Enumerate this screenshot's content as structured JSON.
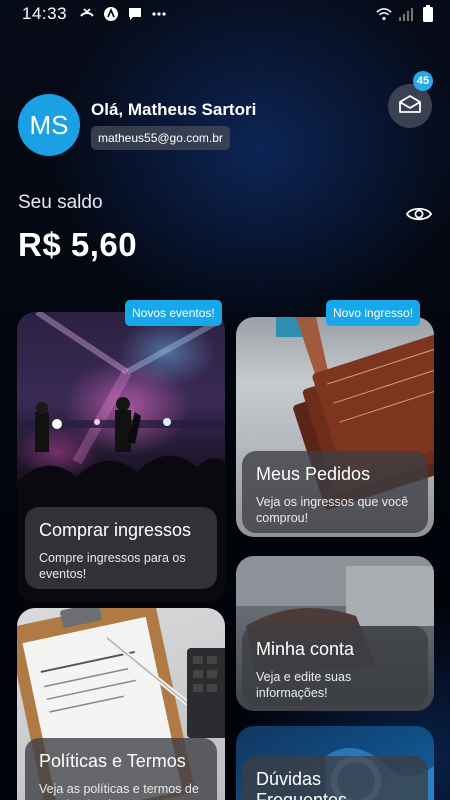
{
  "status_bar": {
    "time": "14:33",
    "icons": [
      "missed-call-icon",
      "app-notification-icon",
      "message-icon",
      "more-dots-icon"
    ],
    "right_icons": [
      "wifi-icon",
      "signal-icon",
      "battery-icon"
    ]
  },
  "header": {
    "avatar_initials": "MS",
    "greeting": "Olá, Matheus Sartori",
    "email": "matheus55@go.com.br",
    "notifications_count": "45"
  },
  "balance": {
    "label": "Seu saldo",
    "value": "R$ 5,60"
  },
  "cards": {
    "buy": {
      "tag": "Novos eventos!",
      "title": "Comprar ingressos",
      "desc": "Compre ingressos para os eventos!"
    },
    "orders": {
      "tag": "Novo ingresso!",
      "title": "Meus Pedidos",
      "desc": "Veja os ingressos que você comprou!"
    },
    "account": {
      "title": "Minha conta",
      "desc": "Veja e edite suas informações!"
    },
    "policies": {
      "title": "Políticas e Termos",
      "desc": "Veja as políticas e termos de uso da plataforma!"
    },
    "faq": {
      "title": "Dúvidas Frequentes"
    }
  },
  "colors": {
    "accent": "#1ba1e3",
    "background": "#02050c",
    "panel": "#3c3e44"
  }
}
